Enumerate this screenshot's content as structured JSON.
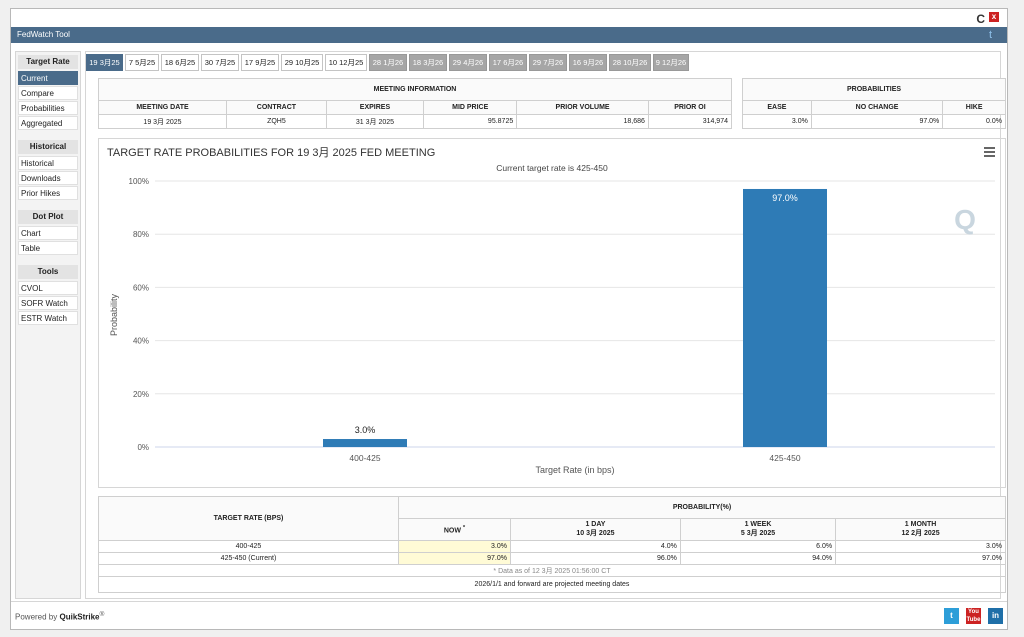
{
  "app": {
    "title": "FedWatch Tool",
    "refresh_glyph": "C",
    "close_glyph": "x",
    "twitter_glyph": "t"
  },
  "sidebar": {
    "sections": [
      {
        "title": "Target Rate",
        "items": [
          "Current",
          "Compare",
          "Probabilities",
          "Aggregated"
        ],
        "active": "Current"
      },
      {
        "title": "Historical",
        "items": [
          "Historical",
          "Downloads",
          "Prior Hikes"
        ]
      },
      {
        "title": "Dot Plot",
        "items": [
          "Chart",
          "Table"
        ]
      },
      {
        "title": "Tools",
        "items": [
          "CVOL",
          "SOFR Watch",
          "ESTR Watch"
        ]
      }
    ]
  },
  "tabs": [
    "19 3月25",
    "7 5月25",
    "18 6月25",
    "30 7月25",
    "17 9月25",
    "29 10月25",
    "10 12月25",
    "28 1月26",
    "18 3月26",
    "29 4月26",
    "17 6月26",
    "29 7月26",
    "16 9月26",
    "28 10月26",
    "9 12月26"
  ],
  "meeting_info": {
    "header": "MEETING INFORMATION",
    "columns": [
      "MEETING DATE",
      "CONTRACT",
      "EXPIRES",
      "MID PRICE",
      "PRIOR VOLUME",
      "PRIOR OI"
    ],
    "values": [
      "19 3月 2025",
      "ZQH5",
      "31 3月 2025",
      "95.8725",
      "18,686",
      "314,974"
    ]
  },
  "probabilities": {
    "header": "PROBABILITIES",
    "columns": [
      "EASE",
      "NO CHANGE",
      "HIKE"
    ],
    "values": [
      "3.0%",
      "97.0%",
      "0.0%"
    ]
  },
  "chart_data": {
    "type": "bar",
    "title": "TARGET RATE PROBABILITIES FOR 19 3月 2025 FED MEETING",
    "subtitle": "Current target rate is 425-450",
    "categories": [
      "400-425",
      "425-450"
    ],
    "values": [
      3.0,
      97.0
    ],
    "value_labels": [
      "3.0%",
      "97.0%"
    ],
    "xlabel": "Target Rate (in bps)",
    "ylabel": "Probability",
    "ylim": [
      0,
      100
    ],
    "yticks": [
      "0%",
      "20%",
      "40%",
      "60%",
      "80%",
      "100%"
    ],
    "bar_color": "#2e7bb6",
    "grid": true
  },
  "prob_table": {
    "col1_header": "TARGET RATE (BPS)",
    "group_header": "PROBABILITY(%)",
    "subheaders": [
      {
        "label": "NOW",
        "date": ""
      },
      {
        "label": "1 DAY",
        "date": "10 3月 2025"
      },
      {
        "label": "1 WEEK",
        "date": "5 3月 2025"
      },
      {
        "label": "1 MONTH",
        "date": "12 2月 2025"
      }
    ],
    "rows": [
      {
        "rate": "400-425",
        "values": [
          "3.0%",
          "4.0%",
          "6.0%",
          "3.0%"
        ]
      },
      {
        "rate": "425-450 (Current)",
        "values": [
          "97.0%",
          "96.0%",
          "94.0%",
          "97.0%"
        ]
      }
    ],
    "data_note": "* Data as of 12 3月 2025 01:56:00 CT",
    "projected_note": "2026/1/1 and forward are projected meeting dates"
  },
  "footer": {
    "powered_by": "Powered by",
    "brand": "QuikStrike",
    "reg": "®",
    "social": [
      "t",
      "You Tube",
      "in"
    ]
  },
  "colors": {
    "accent": "#4a6b8a",
    "bar": "#2e7bb6",
    "now_highlight": "#fffbd6"
  }
}
